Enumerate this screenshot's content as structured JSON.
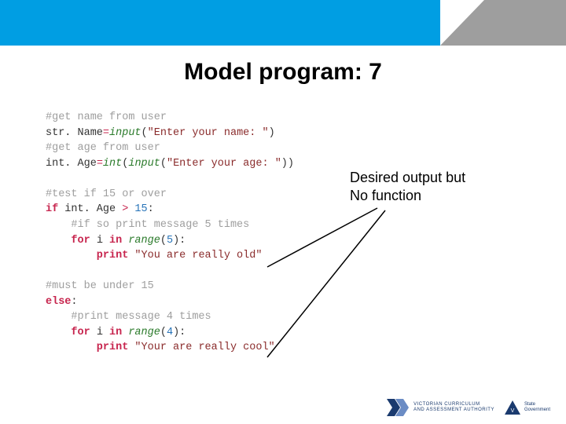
{
  "header": {},
  "title": "Model program: 7",
  "code": {
    "l1": "#get name from user",
    "l2_a": "str. Name",
    "l2_b": "=",
    "l2_c": "input",
    "l2_d": "(",
    "l2_e": "\"Enter your name: \"",
    "l2_f": ")",
    "l3": "#get age from user",
    "l4_a": "int. Age",
    "l4_b": "=",
    "l4_c": "int",
    "l4_d": "(",
    "l4_e": "input",
    "l4_f": "(",
    "l4_g": "\"Enter your age: \"",
    "l4_h": "))",
    "l6": "#test if 15 or over",
    "l7_a": "if",
    "l7_b": " int. Age ",
    "l7_c": ">",
    "l7_d": " 15",
    "l7_e": ":",
    "l8": "    #if so print message 5 times",
    "l9_a": "    for",
    "l9_b": " i ",
    "l9_c": "in",
    "l9_d": " range",
    "l9_e": "(",
    "l9_f": "5",
    "l9_g": "):",
    "l10_a": "        print",
    "l10_b": " \"You are really old\"",
    "l12": "#must be under 15",
    "l13_a": "else",
    "l13_b": ":",
    "l14": "    #print message 4 times",
    "l15_a": "    for",
    "l15_b": " i ",
    "l15_c": "in",
    "l15_d": " range",
    "l15_e": "(",
    "l15_f": "4",
    "l15_g": "):",
    "l16_a": "        print",
    "l16_b": " \"Your are really cool\""
  },
  "annotation": {
    "line1": "Desired output but",
    "line2": "No function"
  },
  "footer": {
    "vcaa_line1": "Victorian Curriculum",
    "vcaa_line2": "and Assessment Authority",
    "vic_line1": "State",
    "vic_line2": "Government"
  }
}
